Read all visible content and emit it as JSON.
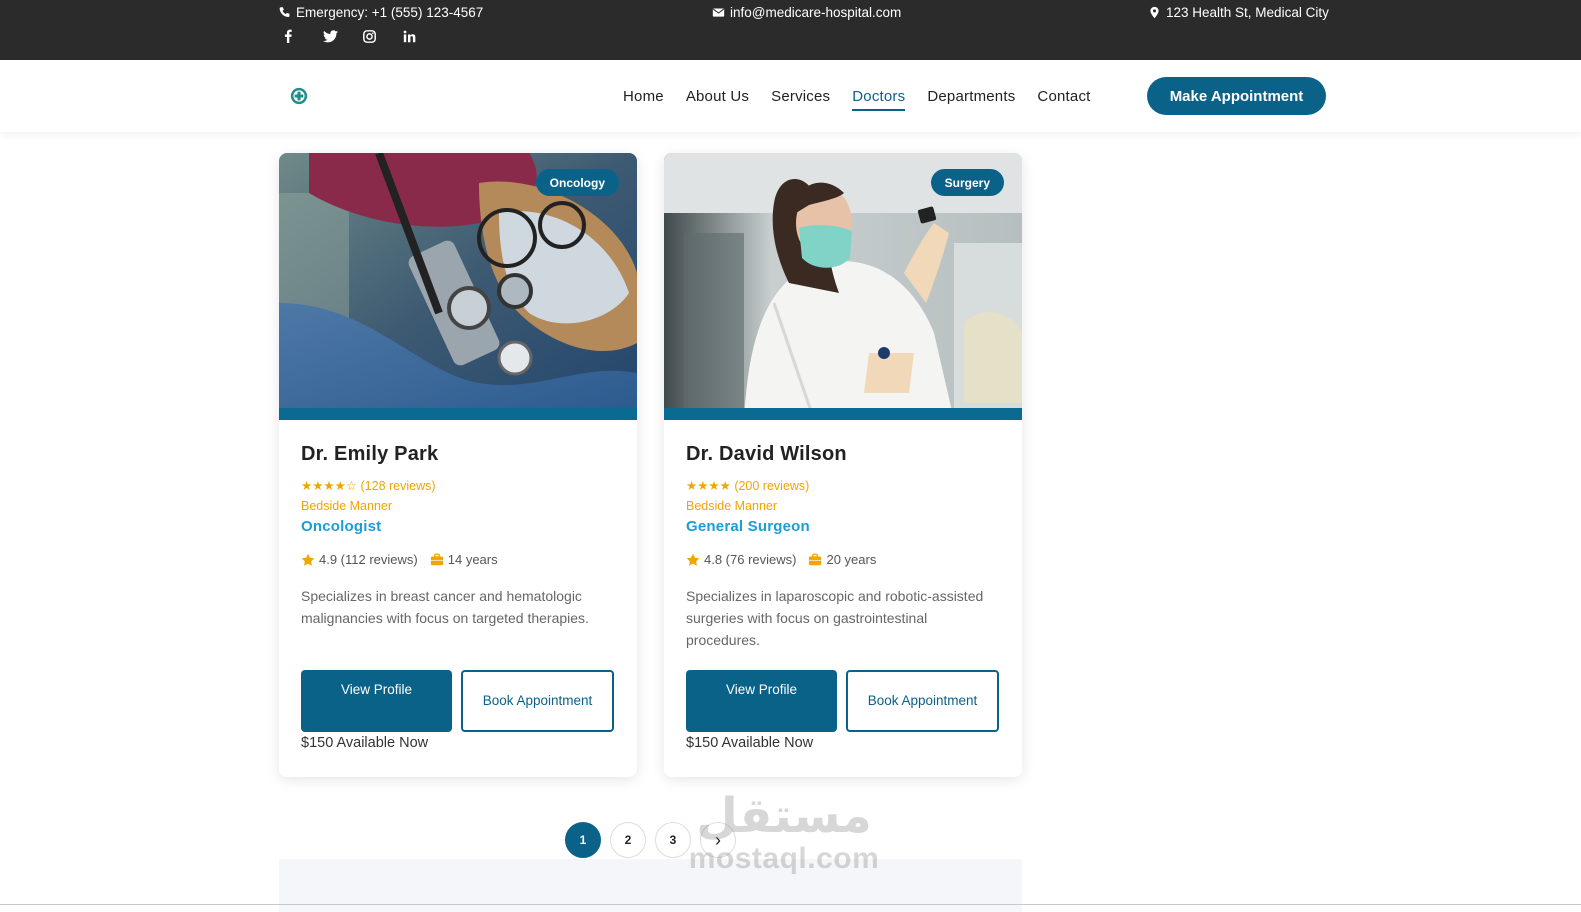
{
  "topbar": {
    "phone": "Emergency: +1 (555) 123-4567",
    "email": "info@medicare-hospital.com",
    "address": "123 Health St, Medical City",
    "socials": [
      "facebook-icon",
      "twitter-icon",
      "instagram-icon",
      "linkedin-icon"
    ]
  },
  "nav": {
    "links": [
      "Home",
      "About Us",
      "Services",
      "Doctors",
      "Departments",
      "Contact"
    ],
    "active": "Doctors",
    "cta": "Make Appointment"
  },
  "doctors": [
    {
      "tag": "Oncology",
      "name": "Dr. Emily Park",
      "stars": "★★★★☆",
      "stars_reviews": "(128 reviews)",
      "bedside": "Bedside Manner",
      "specialty": "Oncologist",
      "rating": "4.9 (112 reviews)",
      "experience": "14 years",
      "description": "Specializes in breast cancer and hematologic malignancies with focus on targeted therapies.",
      "view_profile": "View Profile",
      "book": "Book Appointment",
      "price": "$150 Available Now"
    },
    {
      "tag": "Surgery",
      "name": "Dr. David Wilson",
      "stars": "★★★★",
      "stars_reviews": "(200 reviews)",
      "bedside": "Bedside Manner",
      "specialty": "General Surgeon",
      "rating": "4.8 (76 reviews)",
      "experience": "20 years",
      "description": "Specializes in laparoscopic and robotic-assisted surgeries with focus on gastrointestinal procedures.",
      "view_profile": "View Profile",
      "book": "Book Appointment",
      "price": "$150 Available Now"
    }
  ],
  "pagination": {
    "pages": [
      "1",
      "2",
      "3"
    ],
    "current": "1",
    "next": "›"
  },
  "watermark": {
    "arabic": "مستقل",
    "latin": "mostaql.com"
  },
  "colors": {
    "primary": "#0b6289",
    "accent_star": "#f0a500",
    "specialty": "#1a9ed8",
    "topbar": "#2b2b2b"
  }
}
